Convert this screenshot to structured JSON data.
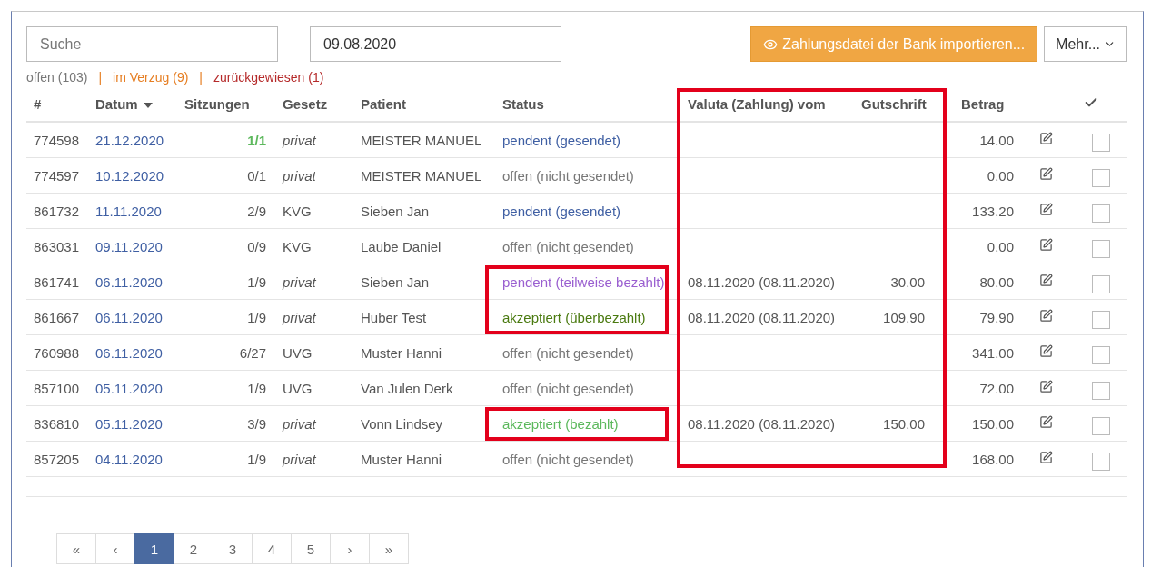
{
  "toolbar": {
    "search": {
      "placeholder": "Suche"
    },
    "date": {
      "value": "09.08.2020"
    },
    "import_button": {
      "label": "Zahlungsdatei der Bank importieren..."
    },
    "more_button": {
      "label": "Mehr..."
    }
  },
  "filters": [
    {
      "label": "offen (103)",
      "kind": "open"
    },
    {
      "label": "im Verzug (9)",
      "kind": "overdue"
    },
    {
      "label": "zurückgewiesen (1)",
      "kind": "rejected"
    }
  ],
  "filter_separator": "|",
  "table": {
    "columns": [
      {
        "label": "#",
        "highlighted": false
      },
      {
        "label": "Datum",
        "sorted": true,
        "highlighted": false
      },
      {
        "label": "Sitzungen",
        "highlighted": false
      },
      {
        "label": "Gesetz",
        "highlighted": false
      },
      {
        "label": "Patient",
        "highlighted": false
      },
      {
        "label": "Status",
        "highlighted": false
      },
      {
        "label": "Valuta (Zahlung) vom",
        "highlighted": true
      },
      {
        "label": "Gutschrift",
        "highlighted": true
      },
      {
        "label": "Betrag",
        "highlighted": false
      },
      {
        "kind": "edit",
        "highlighted": false
      },
      {
        "kind": "check",
        "highlighted": false
      }
    ],
    "rows": [
      {
        "id": "774598",
        "date": "21.12.2020",
        "sessions": {
          "label": "1/1",
          "complete": true
        },
        "law": {
          "label": "privat",
          "kind": "private"
        },
        "patient": "MEISTER MANUEL",
        "status": {
          "label": "pendent (gesendet)",
          "kind": "pending",
          "highlighted": false
        },
        "amount": "14.00",
        "checked": false
      },
      {
        "id": "774597",
        "date": "10.12.2020",
        "sessions": {
          "label": "0/1",
          "complete": false
        },
        "law": {
          "label": "privat",
          "kind": "private"
        },
        "patient": "MEISTER MANUEL",
        "status": {
          "label": "offen (nicht gesendet)",
          "kind": "open",
          "highlighted": false
        },
        "amount": "0.00",
        "checked": false
      },
      {
        "id": "861732",
        "date": "11.11.2020",
        "sessions": {
          "label": "2/9",
          "complete": false
        },
        "law": {
          "label": "KVG",
          "kind": "insurance"
        },
        "patient": "Sieben Jan",
        "status": {
          "label": "pendent (gesendet)",
          "kind": "pending",
          "highlighted": false
        },
        "amount": "133.20",
        "checked": false
      },
      {
        "id": "863031",
        "date": "09.11.2020",
        "sessions": {
          "label": "0/9",
          "complete": false
        },
        "law": {
          "label": "KVG",
          "kind": "insurance"
        },
        "patient": "Laube Daniel",
        "status": {
          "label": "offen (nicht gesendet)",
          "kind": "open",
          "highlighted": false
        },
        "amount": "0.00",
        "checked": false
      },
      {
        "id": "861741",
        "date": "06.11.2020",
        "sessions": {
          "label": "1/9",
          "complete": false
        },
        "law": {
          "label": "privat",
          "kind": "private"
        },
        "patient": "Sieben Jan",
        "status": {
          "label": "pendent (teilweise bezahlt)",
          "kind": "partial",
          "highlighted": true
        },
        "valuta": "08.11.2020 (08.11.2020)",
        "credit": "30.00",
        "amount": "80.00",
        "checked": false
      },
      {
        "id": "861667",
        "date": "06.11.2020",
        "sessions": {
          "label": "1/9",
          "complete": false
        },
        "law": {
          "label": "privat",
          "kind": "private"
        },
        "patient": "Huber Test",
        "status": {
          "label": "akzeptiert (überbezahlt)",
          "kind": "overpaid",
          "highlighted": true
        },
        "valuta": "08.11.2020 (08.11.2020)",
        "credit": "109.90",
        "amount": "79.90",
        "checked": false
      },
      {
        "id": "760988",
        "date": "06.11.2020",
        "sessions": {
          "label": "6/27",
          "complete": false
        },
        "law": {
          "label": "UVG",
          "kind": "insurance"
        },
        "patient": "Muster Hanni",
        "status": {
          "label": "offen (nicht gesendet)",
          "kind": "open",
          "highlighted": false
        },
        "amount": "341.00",
        "checked": false
      },
      {
        "id": "857100",
        "date": "05.11.2020",
        "sessions": {
          "label": "1/9",
          "complete": false
        },
        "law": {
          "label": "UVG",
          "kind": "insurance"
        },
        "patient": "Van Julen Derk",
        "status": {
          "label": "offen (nicht gesendet)",
          "kind": "open",
          "highlighted": false
        },
        "amount": "72.00",
        "checked": false
      },
      {
        "id": "836810",
        "date": "05.11.2020",
        "sessions": {
          "label": "3/9",
          "complete": false
        },
        "law": {
          "label": "privat",
          "kind": "private"
        },
        "patient": "Vonn Lindsey",
        "status": {
          "label": "akzeptiert (bezahlt)",
          "kind": "paid",
          "highlighted": true
        },
        "valuta": "08.11.2020 (08.11.2020)",
        "credit": "150.00",
        "amount": "150.00",
        "checked": false
      },
      {
        "id": "857205",
        "date": "04.11.2020",
        "sessions": {
          "label": "1/9",
          "complete": false
        },
        "law": {
          "label": "privat",
          "kind": "private"
        },
        "patient": "Muster Hanni",
        "status": {
          "label": "offen (nicht gesendet)",
          "kind": "open",
          "highlighted": false
        },
        "amount": "168.00",
        "checked": false
      }
    ]
  },
  "pagination": [
    {
      "label": "«",
      "selected": false
    },
    {
      "label": "‹",
      "selected": false
    },
    {
      "label": "1",
      "selected": true
    },
    {
      "label": "2",
      "selected": false
    },
    {
      "label": "3",
      "selected": false
    },
    {
      "label": "4",
      "selected": false
    },
    {
      "label": "5",
      "selected": false
    },
    {
      "label": "›",
      "selected": false
    },
    {
      "label": "»",
      "selected": false
    }
  ]
}
